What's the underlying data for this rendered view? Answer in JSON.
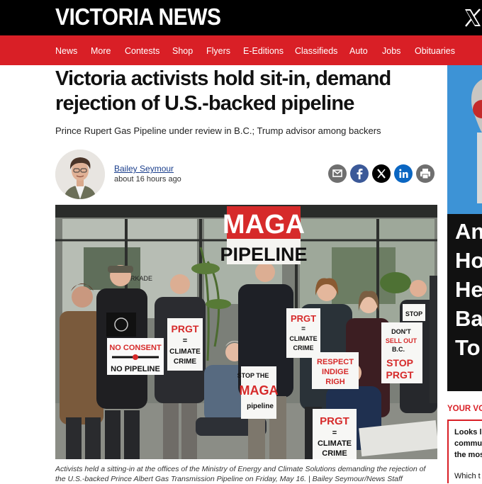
{
  "site": {
    "logo": "VICTORIA NEWS"
  },
  "nav": {
    "items": [
      "News",
      "More",
      "Contests",
      "Shop",
      "Flyers",
      "E-Editions",
      "Classifieds",
      "Auto",
      "Jobs",
      "Obituaries"
    ]
  },
  "article": {
    "headline_line1": "Victoria activists hold sit-in, demand",
    "headline_line2": "rejection of U.S.-backed pipeline",
    "dek": "Prince Rupert Gas Pipeline under review in B.C.; Trump advisor among backers",
    "author": "Bailey Seymour",
    "time": "about 16 hours ago",
    "caption_line1": "Activists held a sitting-in at the offices of the Ministry of Energy and Climate Solutions demanding the rejection of",
    "caption_line2": "the U.S.-backed Prince Albert Gas Transmission Pipeline on Friday, May 16. | Bailey Seymour/News Staff"
  },
  "share": {
    "icons": [
      "email-icon",
      "facebook-icon",
      "x-icon",
      "linkedin-icon",
      "print-icon"
    ]
  },
  "photo_signs": {
    "big_sign_line1": "MAGA",
    "big_sign_line2": "PIPELINE",
    "sign_prgt": "PRGT",
    "sign_equals": "=",
    "sign_climate": "CLIMATE",
    "sign_crime": "CRIME",
    "sign_no_consent": "NO CONSENT",
    "sign_no_pipeline": "NO PIPELINE",
    "sign_stop_the": "STOP THE",
    "sign_maga": "MAGA",
    "sign_pipeline": "pipeline",
    "sign_respect1": "RESPECT",
    "sign_respect2": "INDIGE",
    "sign_respect3": "RIGH",
    "sign_dont1": "DON'T",
    "sign_dont2": "SELL OUT",
    "sign_dont3": "B.C.",
    "sign_stop": "STOP",
    "sign_stop_prgt": "PRGT",
    "sign_stop_small": "STOP",
    "window_text": "ARKADE"
  },
  "rail": {
    "big_words": [
      "An",
      "Ho",
      "He",
      "Ba",
      "To"
    ],
    "section_label": "YOUR VOTE",
    "box_lines": [
      "Looks li",
      "commu",
      "the mos",
      "Which t"
    ]
  },
  "colors": {
    "brand_red": "#d91f26",
    "topbar": "#000000",
    "facebook": "#3b5998",
    "linkedin": "#0a66c2",
    "share_gray": "#6f6f6f"
  }
}
